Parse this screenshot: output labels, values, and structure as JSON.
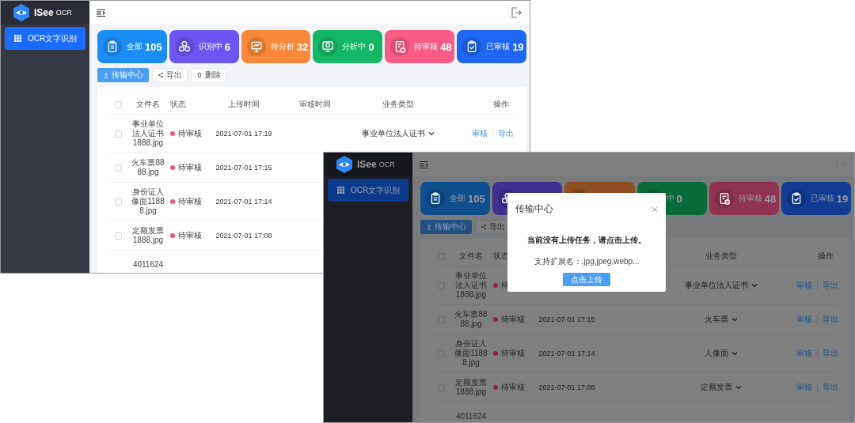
{
  "windows": [
    {
      "brand": {
        "name": "ISee",
        "suffix": "OCR"
      },
      "menu": [
        {
          "label": "OCR文字识别",
          "selected": true
        }
      ],
      "cards": [
        {
          "kind": "all",
          "label": "全部",
          "value": "105",
          "color": "#1b8df5"
        },
        {
          "kind": "recognizing",
          "label": "识别中",
          "value": "6",
          "color": "#6d55f2"
        },
        {
          "kind": "pending_analysis",
          "label": "待分析",
          "value": "32",
          "color": "#f9883a"
        },
        {
          "kind": "analyzing",
          "label": "分析中",
          "value": "0",
          "color": "#13b766"
        },
        {
          "kind": "pending_review",
          "label": "待审核",
          "value": "48",
          "color": "#f85b86"
        },
        {
          "kind": "reviewed",
          "label": "已审核",
          "value": "19",
          "color": "#1f66f2"
        }
      ],
      "toolbar": [
        {
          "kind": "upload",
          "label": "传输中心",
          "primary": true
        },
        {
          "kind": "share",
          "label": "导出",
          "primary": false
        },
        {
          "kind": "delete",
          "label": "删除",
          "primary": false
        }
      ],
      "table": {
        "header_checked": false,
        "columns": [
          {
            "kind": "file",
            "label": "文件名"
          },
          {
            "kind": "status",
            "label": "状态"
          },
          {
            "kind": "upload",
            "label": "上传时间"
          },
          {
            "kind": "review",
            "label": "审核时间"
          },
          {
            "kind": "biz",
            "label": "业务类型"
          },
          {
            "kind": "ops",
            "label": "操作"
          }
        ],
        "rows": [
          {
            "checked": false,
            "file": "事业单位法人证书1888.jpg",
            "status": {
              "label": "待审核",
              "color": "#f5507a"
            },
            "upload_time": "2021-07-01 17:19",
            "business_type": "事业单位法人证书",
            "actions": [
              "审核",
              "导出"
            ]
          },
          {
            "checked": false,
            "file": "火车票8888.jpg",
            "status": {
              "label": "待审核",
              "color": "#f5507a"
            },
            "upload_time": "2021-07-01 17:15"
          },
          {
            "checked": false,
            "file": "身份证人像面11888.jpg",
            "status": {
              "label": "待审核",
              "color": "#f5507a"
            },
            "upload_time": "2021-07-01 17:14"
          },
          {
            "checked": false,
            "file": "定额发票1888.jpg",
            "status": {
              "label": "待审核",
              "color": "#f5507a"
            },
            "upload_time": "2021-07-01 17:08"
          },
          {
            "file": "4011624"
          }
        ]
      }
    },
    {
      "brand": {
        "name": "ISee",
        "suffix": "OCR"
      },
      "menu": [
        {
          "label": "OCR文字识别",
          "selected": true
        }
      ],
      "cards": [
        {
          "kind": "all",
          "label": "全部",
          "value": "105",
          "color": "#0e4f8e"
        },
        {
          "kind": "recognizing",
          "color": "#3e3190"
        },
        {
          "kind": "pending_analysis",
          "color": "#8e4e22"
        },
        {
          "kind": "analyzing",
          "label": "中",
          "value": "0",
          "color": "#0b6a3b"
        },
        {
          "kind": "pending_review",
          "label": "待审核",
          "value": "48",
          "color": "#8f3450"
        },
        {
          "kind": "reviewed",
          "label": "已审核",
          "value": "19",
          "color": "#123d92"
        }
      ],
      "toolbar": [
        {
          "kind": "upload",
          "label": "传输中心",
          "primary": true
        },
        {
          "kind": "share",
          "label": "导出",
          "primary": false
        }
      ],
      "table": {
        "header_checked": false,
        "columns": [
          {
            "kind": "file",
            "label": "文件名"
          },
          {
            "kind": "status",
            "label": "状态"
          },
          {
            "kind": "biz",
            "label": "业务类型"
          },
          {
            "kind": "ops",
            "label": "操作"
          }
        ],
        "rows": [
          {
            "checked": false,
            "file": "事业单位法人证书1888.jpg",
            "status": {
              "label": "待",
              "color": "#8c2a45"
            },
            "business_type": "事业单位法人证书",
            "actions": [
              "审核",
              "导出"
            ]
          },
          {
            "checked": false,
            "file": "火车票8888.jpg",
            "status": {
              "label": "待审核",
              "color": "#8c2a45"
            },
            "upload_time": "2021-07-01 17:15",
            "business_type": "火车票",
            "actions": [
              "审核",
              "导出"
            ]
          },
          {
            "checked": false,
            "file": "身份证人像面11888.jpg",
            "status": {
              "label": "待审核",
              "color": "#8c2a45"
            },
            "upload_time": "2021-07-01 17:14",
            "business_type": "人像面",
            "actions": [
              "审核",
              "导出"
            ]
          },
          {
            "checked": false,
            "file": "定额发票1888.jpg",
            "status": {
              "label": "待审核",
              "color": "#8c2a45"
            },
            "upload_time": "2021-07-01 17:08",
            "business_type": "定额发票",
            "actions": [
              "审核",
              "导出"
            ]
          },
          {
            "file": "4011624"
          }
        ]
      },
      "modal": {
        "title": "传输中心",
        "message": "当前没有上传任务，请点击上传。",
        "extensions": "支持扩展名：.jpg,jpeg,webp...",
        "button": "点击上传"
      }
    }
  ]
}
